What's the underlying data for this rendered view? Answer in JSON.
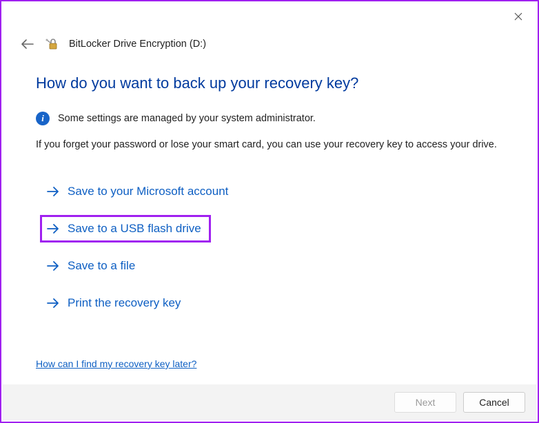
{
  "header": {
    "title": "BitLocker Drive Encryption (D:)"
  },
  "main": {
    "heading": "How do you want to back up your recovery key?",
    "info": "Some settings are managed by your system administrator.",
    "description": "If you forget your password or lose your smart card, you can use your recovery key to access your drive.",
    "options": [
      {
        "label": "Save to your Microsoft account"
      },
      {
        "label": "Save to a USB flash drive"
      },
      {
        "label": "Save to a file"
      },
      {
        "label": "Print the recovery key"
      }
    ],
    "help_link": "How can I find my recovery key later?"
  },
  "footer": {
    "next": "Next",
    "cancel": "Cancel"
  }
}
